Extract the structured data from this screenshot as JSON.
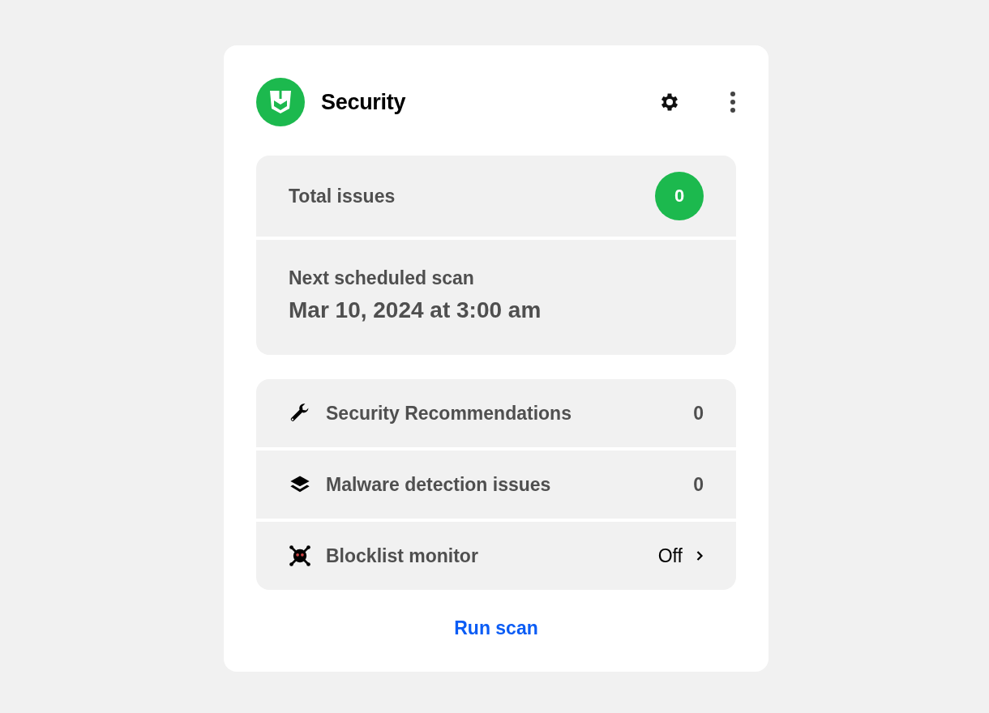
{
  "widget": {
    "title": "Security"
  },
  "summary": {
    "total_label": "Total issues",
    "total_count": "0",
    "scan_label": "Next scheduled scan",
    "scan_time": "Mar 10, 2024 at 3:00 am"
  },
  "rows": [
    {
      "kind": "count",
      "label": "Security Recommendations",
      "value": "0"
    },
    {
      "kind": "count",
      "label": "Malware detection issues",
      "value": "0"
    },
    {
      "kind": "link",
      "label": "Blocklist monitor",
      "value": "Off"
    }
  ],
  "action": "Run scan"
}
